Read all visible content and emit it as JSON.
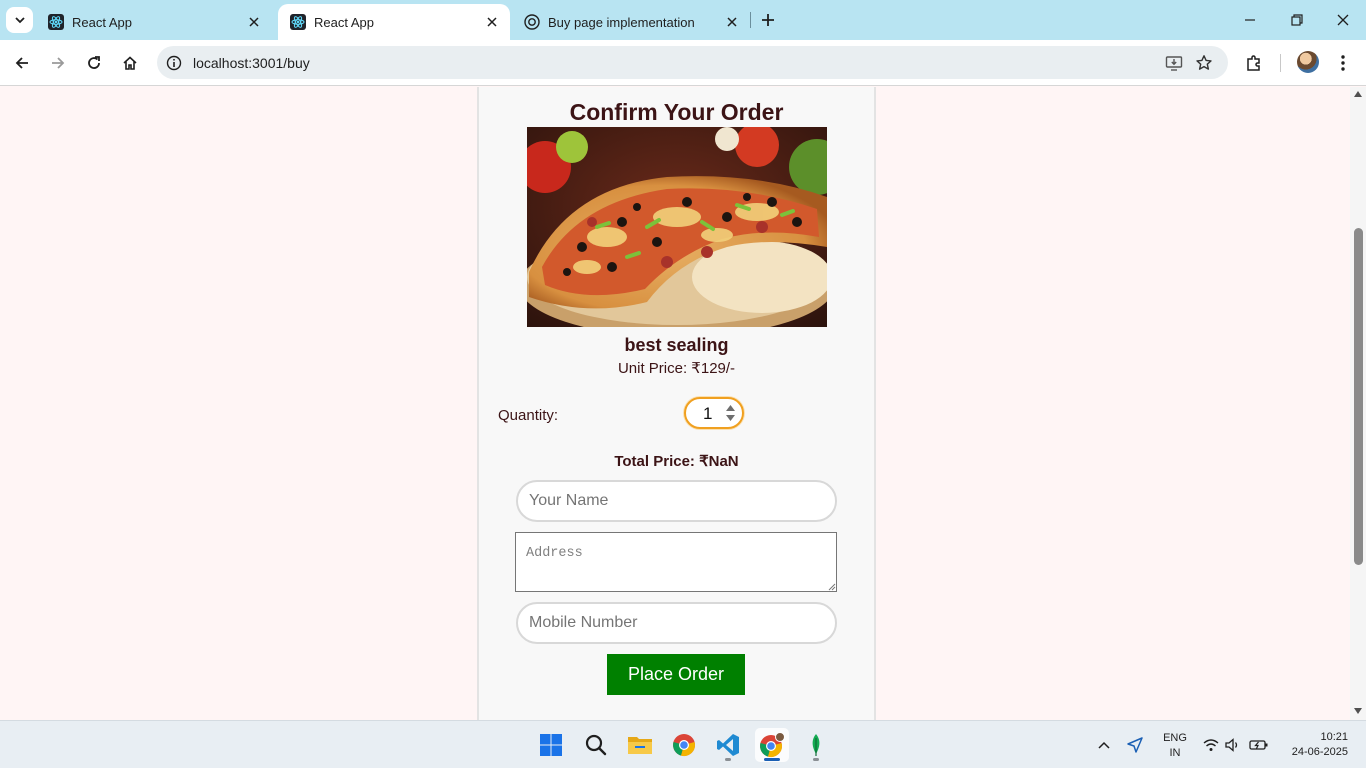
{
  "browser": {
    "tabs": [
      {
        "title": "React App",
        "icon": "react-icon",
        "active": false
      },
      {
        "title": "React App",
        "icon": "react-icon",
        "active": true
      },
      {
        "title": "Buy page implementation",
        "icon": "chatgpt-icon",
        "active": false
      }
    ],
    "url": "localhost:3001/buy"
  },
  "page": {
    "title": "Confirm Your Order",
    "product_name": "best sealing",
    "unit_price": "Unit Price: ₹129/-",
    "quantity_label": "Quantity:",
    "quantity_value": "1",
    "total_price": "Total Price: ₹NaN",
    "name_placeholder": "Your Name",
    "address_placeholder": "Address",
    "mobile_placeholder": "Mobile Number",
    "place_order_label": "Place Order"
  },
  "taskbar": {
    "apps": [
      "start-icon",
      "search-icon",
      "file-explorer-icon",
      "chrome-icon",
      "vscode-icon",
      "chrome-profile-icon",
      "mongodb-compass-icon"
    ],
    "language": {
      "line1": "ENG",
      "line2": "IN"
    },
    "time": "10:21",
    "date": "24-06-2025"
  },
  "colors": {
    "tabstrip": "#b8e4f2",
    "page_background": "#fff5f5",
    "heading_text": "#3c1416",
    "place_order_button": "#008000",
    "quantity_focus_ring": "#f0a020"
  }
}
